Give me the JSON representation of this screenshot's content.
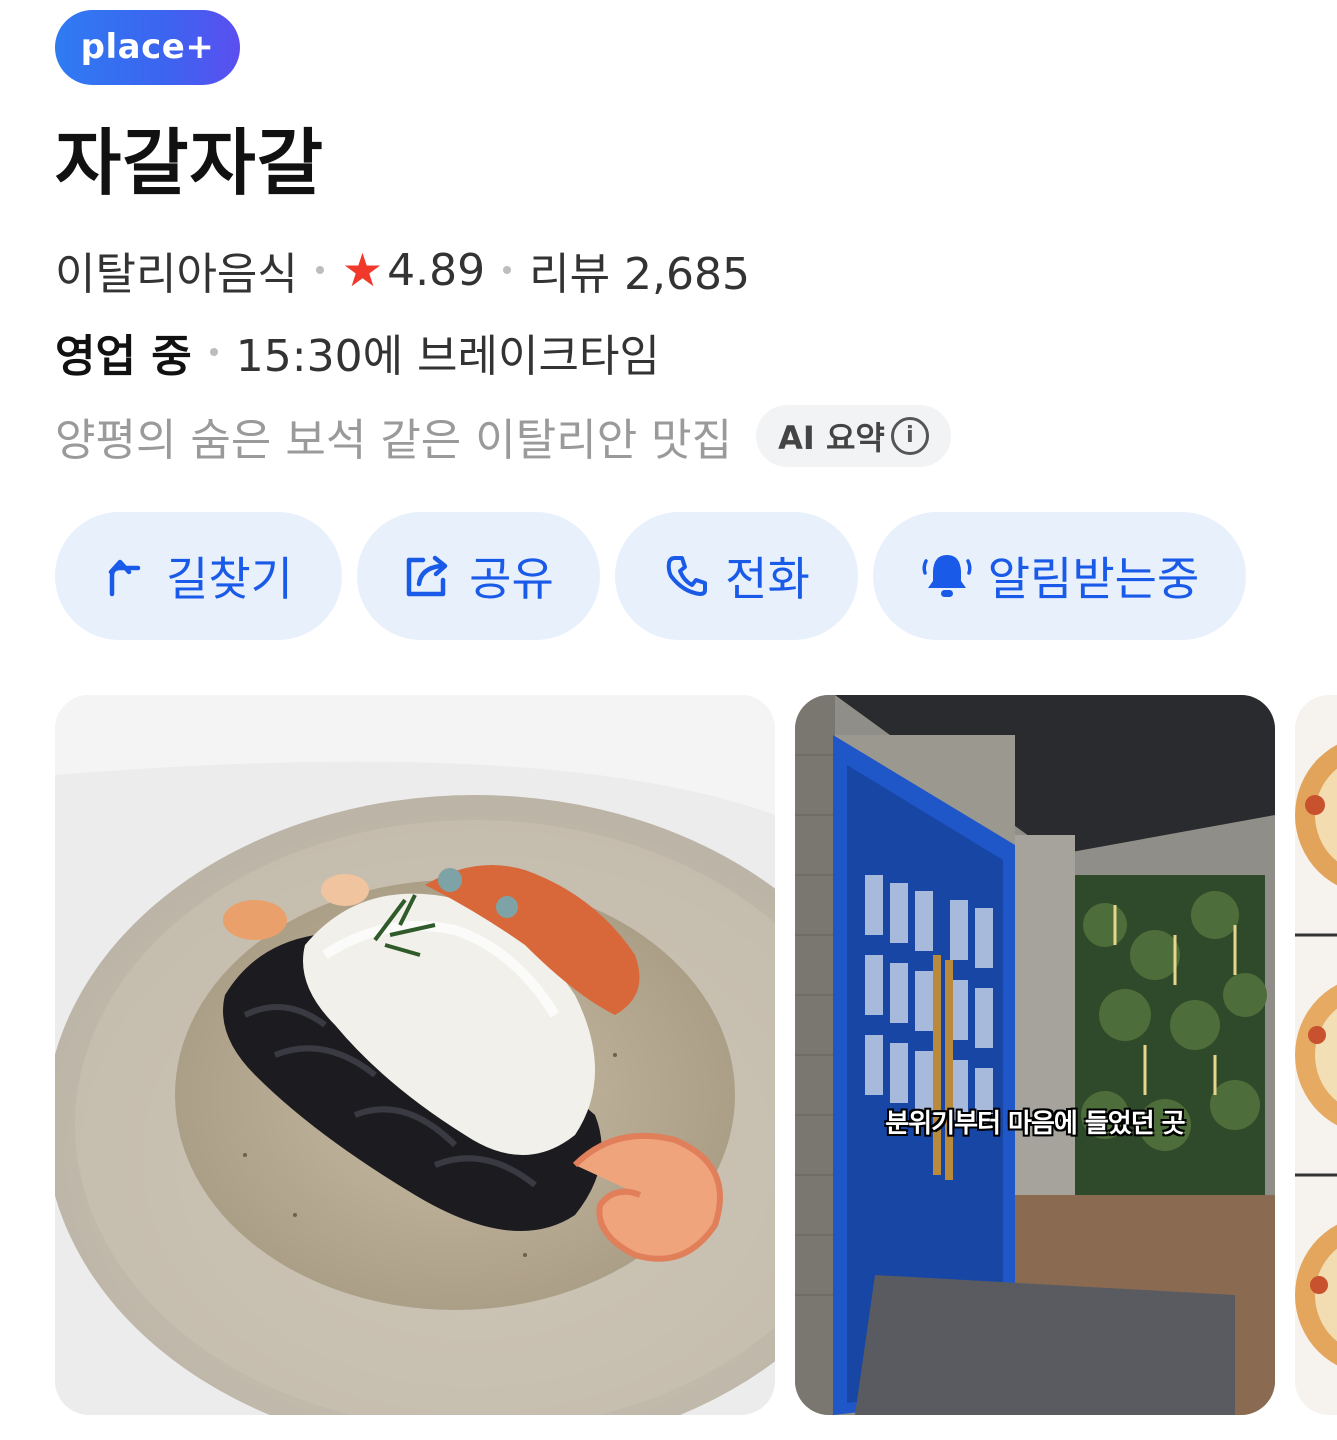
{
  "badge": {
    "label": "place+"
  },
  "place": {
    "name": "자갈자갈",
    "category": "이탈리아음식",
    "rating": "4.89",
    "reviews": "리뷰 2,685",
    "status": "영업 중",
    "hours_note": "15:30에 브레이크타임",
    "summary": "양평의 숨은 보석 같은 이탈리안 맛집",
    "ai_label": "AI 요약"
  },
  "actions": [
    {
      "label": "길찾기",
      "icon": "directions-arrow-icon"
    },
    {
      "label": "공유",
      "icon": "share-icon"
    },
    {
      "label": "전화",
      "icon": "phone-icon"
    },
    {
      "label": "알림받는중",
      "icon": "bell-icon"
    }
  ],
  "gallery": {
    "photos": [
      {
        "subject": "squid-ink-pasta-dish"
      },
      {
        "subject": "restaurant-entrance-blue-door",
        "caption": "분위기부터 마음에 들었던 곳"
      },
      {
        "subject": "pizza-partial"
      }
    ]
  },
  "colors": {
    "accent": "#1a5ae8",
    "action_bg": "#e8f0fc",
    "star": "#f0392b",
    "badge_start": "#2f7bf2",
    "badge_end": "#5b4ff0"
  }
}
